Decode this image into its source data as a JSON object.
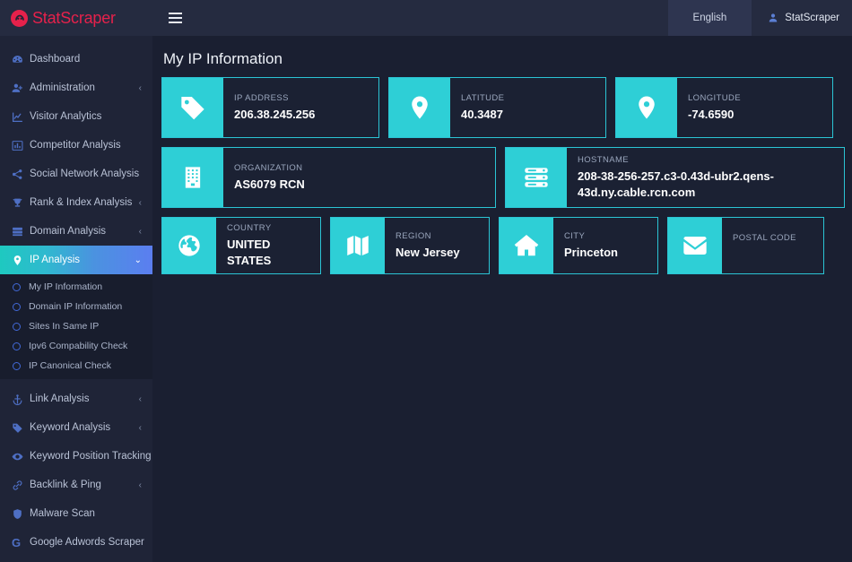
{
  "brand": {
    "name": "StatScraper",
    "color": "#e6214b",
    "mark_icon": "circle-logo-icon"
  },
  "topbar": {
    "menu_toggle_icon": "hamburger-icon",
    "language": "English",
    "user": "StatScraper",
    "user_icon": "user-icon"
  },
  "sidebar": {
    "items": [
      {
        "label": "Dashboard",
        "icon": "dashboard-icon",
        "caret": "",
        "active": false
      },
      {
        "label": "Administration",
        "icon": "user-plus-icon",
        "caret": "‹",
        "active": false
      },
      {
        "label": "Visitor Analytics",
        "icon": "line-chart-icon",
        "caret": "",
        "active": false
      },
      {
        "label": "Competitor Analysis",
        "icon": "bar-chart-icon",
        "caret": "",
        "active": false
      },
      {
        "label": "Social Network Analysis",
        "icon": "share-icon",
        "caret": "",
        "active": false
      },
      {
        "label": "Rank & Index Analysis",
        "icon": "trophy-icon",
        "caret": "‹",
        "active": false
      },
      {
        "label": "Domain Analysis",
        "icon": "server-icon",
        "caret": "‹",
        "active": false
      },
      {
        "label": "IP Analysis",
        "icon": "map-pin-icon",
        "caret": "⌄",
        "active": true
      }
    ],
    "submenu": [
      {
        "label": "My IP Information",
        "icon": "circle-outline-icon"
      },
      {
        "label": "Domain IP Information",
        "icon": "circle-outline-icon"
      },
      {
        "label": "Sites In Same IP",
        "icon": "circle-outline-icon"
      },
      {
        "label": "Ipv6 Compability Check",
        "icon": "circle-outline-icon"
      },
      {
        "label": "IP Canonical Check",
        "icon": "circle-outline-icon"
      }
    ],
    "items_lower": [
      {
        "label": "Link Analysis",
        "icon": "anchor-icon",
        "caret": "‹"
      },
      {
        "label": "Keyword Analysis",
        "icon": "tag-icon",
        "caret": "‹"
      },
      {
        "label": "Keyword Position Tracking",
        "icon": "eye-icon",
        "caret": "‹"
      },
      {
        "label": "Backlink & Ping",
        "icon": "link-icon",
        "caret": "‹"
      },
      {
        "label": "Malware Scan",
        "icon": "shield-icon",
        "caret": ""
      },
      {
        "label": "Google Adwords Scraper",
        "icon": "google-g-icon",
        "caret": ""
      }
    ]
  },
  "main": {
    "title": "My IP Information",
    "accent_color": "#2ecfd6",
    "cards": {
      "ip": {
        "label": "IP ADDRESS",
        "value": "206.38.245.256",
        "icon": "tag-icon"
      },
      "latitude": {
        "label": "LATITUDE",
        "value": "40.3487",
        "icon": "map-pin-icon"
      },
      "longitude": {
        "label": "LONGITUDE",
        "value": "-74.6590",
        "icon": "map-pin-icon"
      },
      "organization": {
        "label": "ORGANIZATION",
        "value": "AS6079 RCN",
        "icon": "building-icon"
      },
      "hostname": {
        "label": "HOSTNAME",
        "value": "208-38-256-257.c3-0.43d-ubr2.qens-43d.ny.cable.rcn.com",
        "icon": "server-rack-icon"
      },
      "country": {
        "label": "COUNTRY",
        "value": "UNITED STATES",
        "icon": "globe-icon"
      },
      "region": {
        "label": "REGION",
        "value": "New Jersey",
        "icon": "map-icon"
      },
      "city": {
        "label": "CITY",
        "value": "Princeton",
        "icon": "home-icon"
      },
      "postal": {
        "label": "POSTAL CODE",
        "value": "",
        "icon": "envelope-icon"
      }
    }
  }
}
